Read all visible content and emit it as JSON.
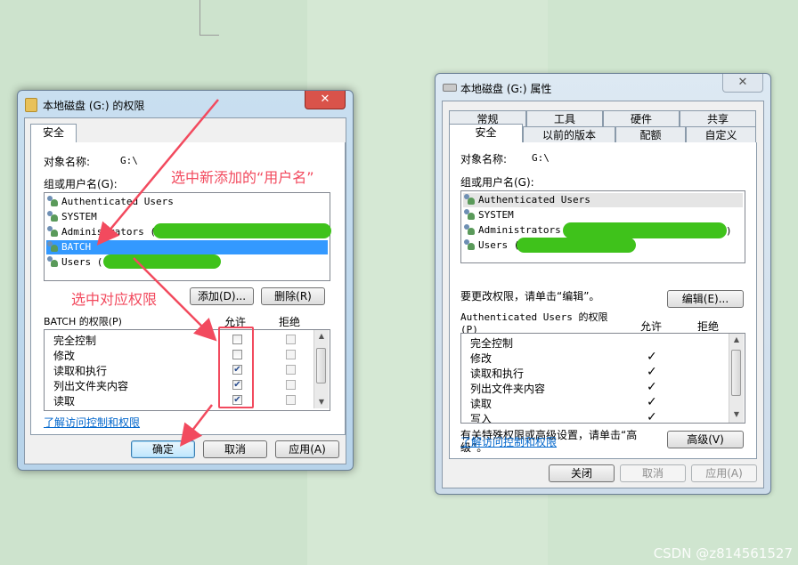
{
  "left_dialog": {
    "title": "本地磁盘 (G:) 的权限",
    "close_glyph": "✕",
    "tab": "安全",
    "object_name_label": "对象名称:",
    "object_name_value": "G:\\",
    "group_label": "组或用户名(G):",
    "users": [
      {
        "name": "Authenticated Users"
      },
      {
        "name": "SYSTEM"
      },
      {
        "name": "Administrators ("
      },
      {
        "name": "BATCH"
      },
      {
        "name": "Users ("
      }
    ],
    "add_button": "添加(D)...",
    "remove_button": "删除(R)",
    "permissions_label": "BATCH 的权限(P)",
    "allow_header": "允许",
    "deny_header": "拒绝",
    "permissions": [
      {
        "name": "完全控制",
        "allow": false,
        "deny": false
      },
      {
        "name": "修改",
        "allow": false,
        "deny": false
      },
      {
        "name": "读取和执行",
        "allow": true,
        "deny": false
      },
      {
        "name": "列出文件夹内容",
        "allow": true,
        "deny": false
      },
      {
        "name": "读取",
        "allow": true,
        "deny": false
      }
    ],
    "learn_link": "了解访问控制和权限",
    "ok_button": "确定",
    "cancel_button": "取消",
    "apply_button": "应用(A)"
  },
  "right_dialog": {
    "title": "本地磁盘 (G:) 属性",
    "close_glyph": "✕",
    "tabs_row1": [
      "常规",
      "工具",
      "硬件",
      "共享"
    ],
    "tabs_row2": [
      "安全",
      "以前的版本",
      "配额",
      "自定义"
    ],
    "object_name_label": "对象名称:",
    "object_name_value": "G:\\",
    "group_label": "组或用户名(G):",
    "users": [
      {
        "name": "Authenticated Users"
      },
      {
        "name": "SYSTEM"
      },
      {
        "name": "Administrators ("
      },
      {
        "name": "Users ("
      }
    ],
    "administrators_suffix": ")",
    "change_hint": "要更改权限，请单击“编辑”。",
    "edit_button": "编辑(E)...",
    "permissions_label": "Authenticated Users 的权限",
    "permissions_label_key": "(P)",
    "allow_header": "允许",
    "deny_header": "拒绝",
    "permissions": [
      {
        "name": "完全控制",
        "allow": false
      },
      {
        "name": "修改",
        "allow": true
      },
      {
        "name": "读取和执行",
        "allow": true
      },
      {
        "name": "列出文件夹内容",
        "allow": true
      },
      {
        "name": "读取",
        "allow": true
      },
      {
        "name": "写入",
        "allow": true
      }
    ],
    "check_glyph": "✓",
    "advanced_hint_line1": "有关特殊权限或高级设置，请单击“高",
    "advanced_hint_line2": "级”。",
    "advanced_button": "高级(V)",
    "learn_link": "了解访问控制和权限",
    "close_button": "关闭",
    "cancel_button": "取消",
    "apply_button": "应用(A)"
  },
  "annotations": {
    "select_user": "选中新添加的“用户名”",
    "select_permissions": "选中对应权限"
  },
  "watermark": "CSDN @z814561527",
  "colors": {
    "annotation": "#f24a5e",
    "selection": "#3399ff",
    "redaction": "#3fc21b"
  }
}
